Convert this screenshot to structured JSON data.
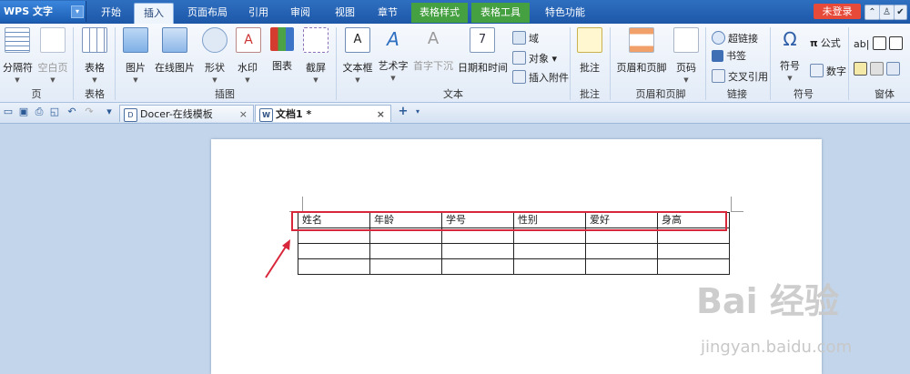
{
  "app": {
    "name": "WPS 文字"
  },
  "tabs": [
    {
      "label": "开始"
    },
    {
      "label": "插入"
    },
    {
      "label": "页面布局"
    },
    {
      "label": "引用"
    },
    {
      "label": "审阅"
    },
    {
      "label": "视图"
    },
    {
      "label": "章节"
    },
    {
      "label": "表格样式"
    },
    {
      "label": "表格工具"
    },
    {
      "label": "特色功能"
    }
  ],
  "login_label": "未登录",
  "ribbon": {
    "buttons": {
      "page_break": "分隔符",
      "blank_page": "空白页",
      "table": "表格",
      "picture": "图片",
      "online_picture": "在线图片",
      "shape": "形状",
      "watermark": "水印",
      "chart": "图表",
      "screenshot": "截屏",
      "textbox": "文本框",
      "wordart": "艺术字",
      "dropcap": "首字下沉",
      "datetime": "日期和时间",
      "field": "域",
      "object": "对象",
      "attachment": "插入附件",
      "comment": "批注",
      "header_footer": "页眉和页脚",
      "page_number": "页码",
      "hyperlink": "超链接",
      "bookmark": "书签",
      "crossref": "交叉引用",
      "symbol": "符号",
      "formula": "公式",
      "number": "数字"
    },
    "groups": {
      "page": "页",
      "table": "表格",
      "illustration": "插图",
      "text": "文本",
      "comment": "批注",
      "header_footer": "页眉和页脚",
      "link": "链接",
      "symbol": "符号",
      "window": "窗体"
    }
  },
  "doc_tabs": [
    {
      "label": "Docer-在线模板"
    },
    {
      "label": "文档1 *"
    }
  ],
  "table": {
    "headers": [
      "姓名",
      "年龄",
      "学号",
      "性别",
      "爱好",
      "身高"
    ],
    "empty_rows": 3
  },
  "watermark": {
    "brand": "Bai 经验",
    "url": "jingyan.baidu.com"
  }
}
